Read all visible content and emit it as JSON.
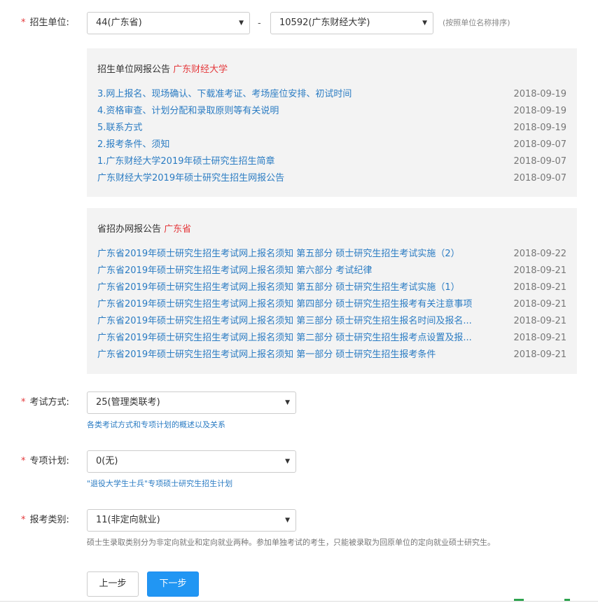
{
  "unit": {
    "label": "招生单位:",
    "province_select": "44(广东省)",
    "dash": "-",
    "school_select": "10592(广东财经大学)",
    "hint": "(按照单位名称排序)"
  },
  "school_panel": {
    "title": "招生单位网报公告",
    "title_accent": "广东财经大学",
    "items": [
      {
        "text": "3.网上报名、现场确认、下载准考证、考场座位安排、初试时间",
        "date": "2018-09-19"
      },
      {
        "text": "4.资格审查、计划分配和录取原则等有关说明",
        "date": "2018-09-19"
      },
      {
        "text": "5.联系方式",
        "date": "2018-09-19"
      },
      {
        "text": "2.报考条件、须知",
        "date": "2018-09-07"
      },
      {
        "text": "1.广东财经大学2019年硕士研究生招生简章",
        "date": "2018-09-07"
      },
      {
        "text": "广东财经大学2019年硕士研究生招生网报公告",
        "date": "2018-09-07"
      }
    ]
  },
  "province_panel": {
    "title": "省招办网报公告",
    "title_accent": "广东省",
    "items": [
      {
        "text": "广东省2019年硕士研究生招生考试网上报名须知 第五部分 硕士研究生招生考试实施（2）",
        "date": "2018-09-22"
      },
      {
        "text": "广东省2019年硕士研究生招生考试网上报名须知 第六部分 考试纪律",
        "date": "2018-09-21"
      },
      {
        "text": "广东省2019年硕士研究生招生考试网上报名须知 第五部分 硕士研究生招生考试实施（1）",
        "date": "2018-09-21"
      },
      {
        "text": "广东省2019年硕士研究生招生考试网上报名须知 第四部分 硕士研究生招生报考有关注意事项",
        "date": "2018-09-21"
      },
      {
        "text": "广东省2019年硕士研究生招生考试网上报名须知 第三部分 硕士研究生招生报名时间及报名...",
        "date": "2018-09-21"
      },
      {
        "text": "广东省2019年硕士研究生招生考试网上报名须知 第二部分 硕士研究生招生报考点设置及报...",
        "date": "2018-09-21"
      },
      {
        "text": "广东省2019年硕士研究生招生考试网上报名须知 第一部分 硕士研究生招生报考条件",
        "date": "2018-09-21"
      }
    ]
  },
  "exam_mode": {
    "label": "考试方式:",
    "value": "25(管理类联考)",
    "link": "各类考试方式和专项计划的概述以及关系"
  },
  "special_plan": {
    "label": "专项计划:",
    "value": "0(无)",
    "link": "\"退役大学生士兵\"专项硕士研究生招生计划"
  },
  "category": {
    "label": "报考类别:",
    "value": "11(非定向就业)",
    "note": "硕士生录取类别分为非定向就业和定向就业两种。参加单独考试的考生，只能被录取为回原单位的定向就业硕士研究生。"
  },
  "buttons": {
    "prev": "上一步",
    "next": "下一步"
  },
  "icons": {
    "required": "*",
    "dropdown": "▼"
  },
  "colors": {
    "accent_red": "#e4393c",
    "link_blue": "#2b7cc3",
    "primary_button": "#2196f3"
  }
}
